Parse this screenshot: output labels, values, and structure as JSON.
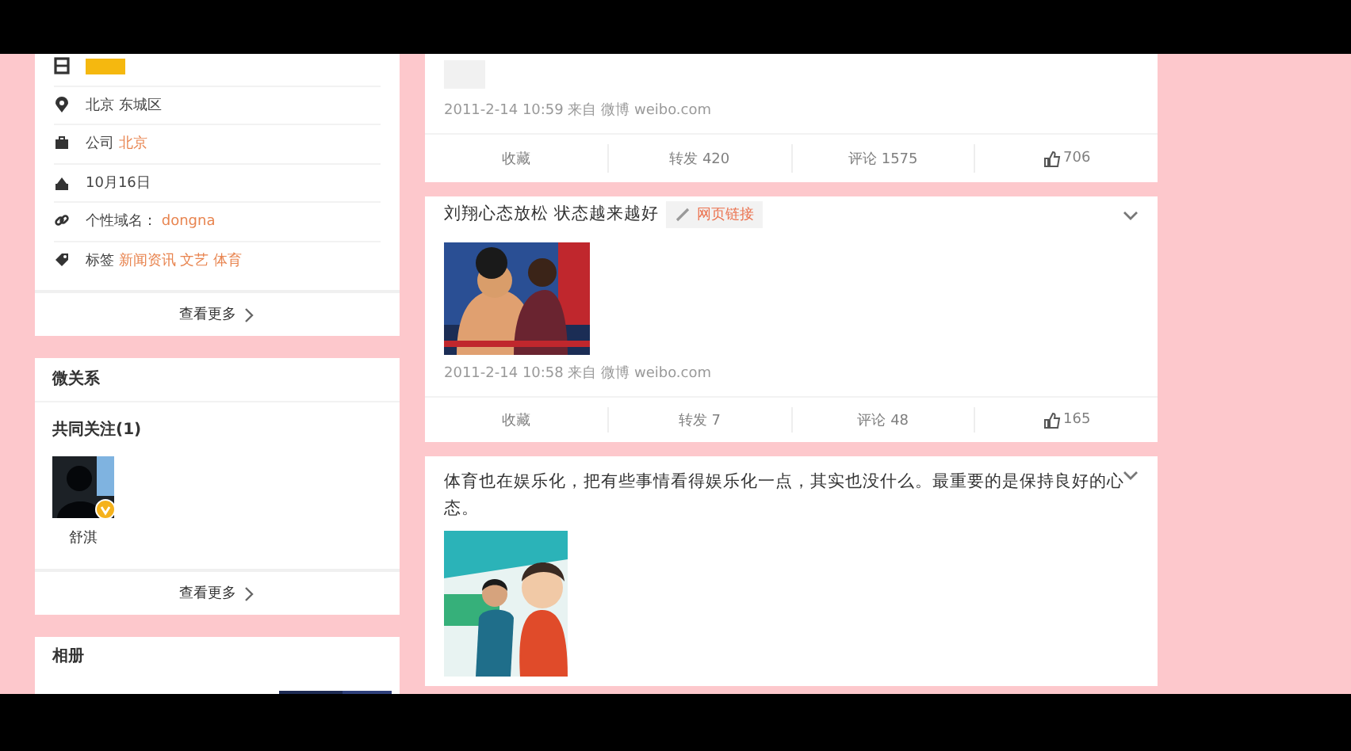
{
  "profile": {
    "rows": [
      {
        "kind": "level"
      },
      {
        "kind": "location",
        "label": "北京 东城区"
      },
      {
        "kind": "company",
        "label": "公司",
        "link": "北京"
      },
      {
        "kind": "birthday",
        "label": "10月16日"
      },
      {
        "kind": "domain",
        "label": "个性域名：",
        "link": "dongna"
      },
      {
        "kind": "tags",
        "label": "标签",
        "link": "新闻资讯 文艺 体育"
      }
    ],
    "more": "查看更多"
  },
  "relations": {
    "title": "微关系",
    "section": "共同关注(1)",
    "friends": [
      {
        "name": "舒淇",
        "verified": true
      }
    ],
    "more": "查看更多"
  },
  "album": {
    "title": "相册"
  },
  "posts": [
    {
      "media": {
        "kind": "placeholder"
      },
      "menu_icon": false,
      "time": "2011-2-14 10:59 来自 微博 weibo.com",
      "actions": [
        "收藏",
        "转发 420",
        "评论 1575"
      ],
      "likes": "706"
    },
    {
      "text": "刘翔心态放松 状态越来越好",
      "link_label": "网页链接",
      "menu_icon": true,
      "time": "2011-2-14 10:58 来自 微博 weibo.com",
      "actions": [
        "收藏",
        "转发 7",
        "评论 48"
      ],
      "likes": "165"
    },
    {
      "text": "体育也在娱乐化，把有些事情看得娱乐化一点，其实也没什么。最重要的是保持良好的心态。",
      "menu_icon": true
    }
  ]
}
